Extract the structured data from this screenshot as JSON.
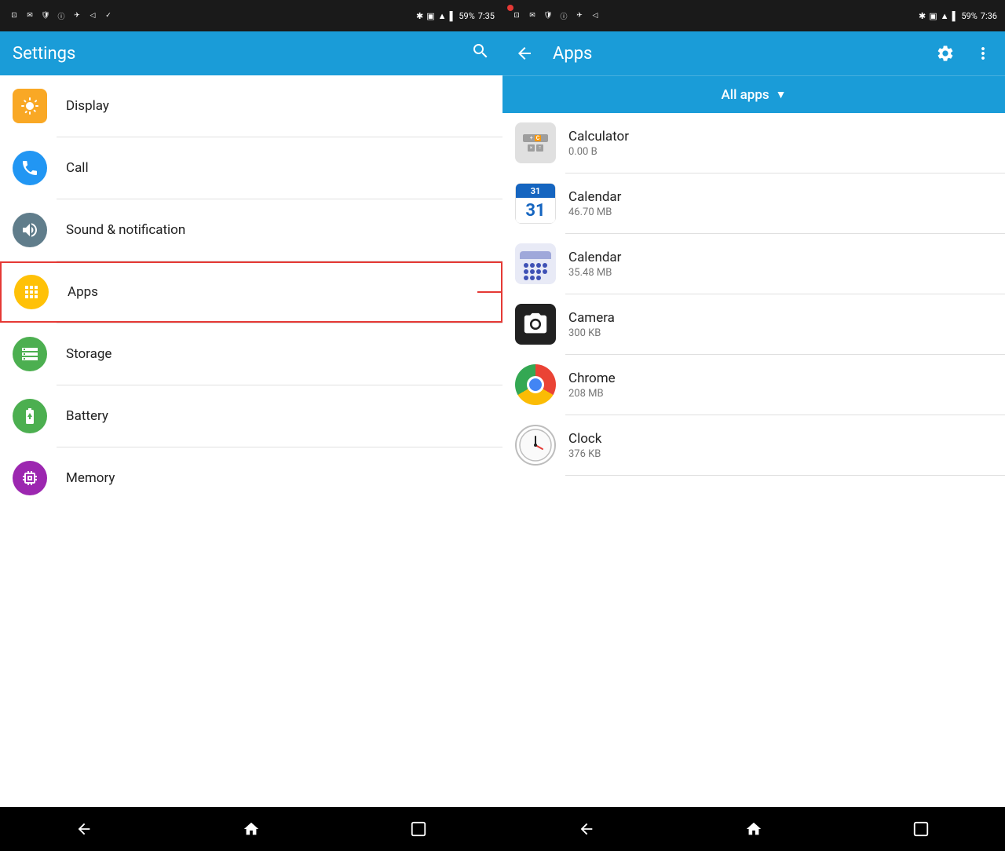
{
  "left": {
    "statusBar": {
      "time": "7:35",
      "battery": "59%"
    },
    "appBar": {
      "title": "Settings",
      "searchLabel": "search"
    },
    "settingsItems": [
      {
        "id": "display",
        "label": "Display",
        "iconColor": "#f9a825",
        "iconType": "display"
      },
      {
        "id": "call",
        "label": "Call",
        "iconColor": "#2196f3",
        "iconType": "call"
      },
      {
        "id": "sound",
        "label": "Sound & notification",
        "iconColor": "#607d8b",
        "iconType": "sound"
      },
      {
        "id": "apps",
        "label": "Apps",
        "iconColor": "#ffc107",
        "iconType": "apps",
        "highlighted": true
      },
      {
        "id": "storage",
        "label": "Storage",
        "iconColor": "#4caf50",
        "iconType": "storage"
      },
      {
        "id": "battery",
        "label": "Battery",
        "iconColor": "#4caf50",
        "iconType": "battery"
      },
      {
        "id": "memory",
        "label": "Memory",
        "iconColor": "#9c27b0",
        "iconType": "memory"
      }
    ],
    "navBar": {
      "backLabel": "back",
      "homeLabel": "home",
      "recentLabel": "recent"
    }
  },
  "right": {
    "statusBar": {
      "time": "7:36",
      "battery": "59%"
    },
    "appBar": {
      "title": "Apps",
      "backLabel": "back",
      "settingsLabel": "settings",
      "moreLabel": "more"
    },
    "filterBar": {
      "label": "All apps",
      "arrowLabel": "dropdown"
    },
    "appsList": [
      {
        "id": "calculator",
        "name": "Calculator",
        "size": "0.00 B",
        "iconType": "calculator"
      },
      {
        "id": "calendar-google",
        "name": "Calendar",
        "size": "46.70 MB",
        "iconType": "gcalendar"
      },
      {
        "id": "calendar-2",
        "name": "Calendar",
        "size": "35.48 MB",
        "iconType": "calendar2"
      },
      {
        "id": "camera",
        "name": "Camera",
        "size": "300 KB",
        "iconType": "camera"
      },
      {
        "id": "chrome",
        "name": "Chrome",
        "size": "208 MB",
        "iconType": "chrome"
      },
      {
        "id": "clock",
        "name": "Clock",
        "size": "376 KB",
        "iconType": "clock"
      }
    ],
    "navBar": {
      "backLabel": "back",
      "homeLabel": "home",
      "recentLabel": "recent"
    }
  }
}
